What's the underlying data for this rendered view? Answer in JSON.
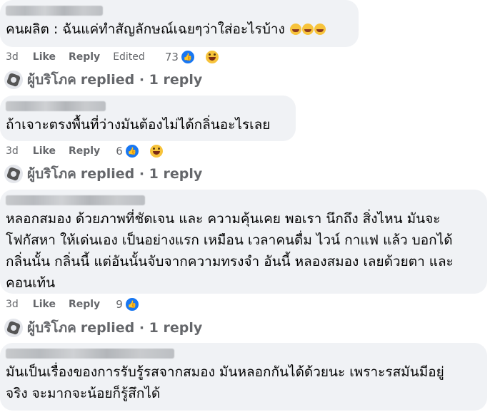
{
  "comments": [
    {
      "text_lines": [
        "คนผลิต : ฉันแค่ทำสัญลักษณ์เฉยๆว่าใส่อะไรบ้าง"
      ],
      "emoji_count": 3,
      "time": "3d",
      "like": "Like",
      "reply": "Reply",
      "edited": "Edited",
      "reaction_count": "73",
      "reactions": [
        "like-icon",
        "haha-icon"
      ]
    },
    {
      "text_lines": [
        "ถ้าเจาะตรงพื้นที่ว่างมันต้องไม่ได้กลิ่นอะไรเลย"
      ],
      "time": "3d",
      "like": "Like",
      "reply": "Reply",
      "reaction_count": "6",
      "reactions": [
        "like-icon",
        "haha-icon"
      ]
    },
    {
      "text_lines": [
        "หลอกสมอง ด้วยภาพที่ชัดเจน และ ความคุ้นเคย พอเรา นึกถึง สิ่งไหน มันจะ",
        "โฟกัสหา ให้เด่นเอง เป็นอย่างแรก เหมือน เวลาคนดื่ม ไวน์ กาแฟ แล้ว บอกได้",
        "กลิ่นนั้น กลิ่นนี้ แต่อันนั้นจับจากความทรงจำ อันนี้ หลองสมอง เลยด้วยตา และ",
        "คอนเท้น"
      ],
      "time": "3d",
      "like": "Like",
      "reply": "Reply",
      "reaction_count": "9",
      "reactions": [
        "like-icon"
      ]
    },
    {
      "text_lines": [
        "มันเป็นเรื่องของการรับรู้รสจากสมอง มันหลอกกันได้ด้วยนะ เพราะรสมันมีอยู่",
        "จริง จะมากจะน้อยก็รู้สึกได้"
      ]
    }
  ],
  "reply_rows": [
    {
      "name": "ผู้บริโภค",
      "text": "replied · 1 reply"
    },
    {
      "name": "ผู้บริโภค",
      "text": "replied · 1 reply"
    },
    {
      "name": "ผู้บริโภค",
      "text": "replied · 1 reply"
    }
  ]
}
